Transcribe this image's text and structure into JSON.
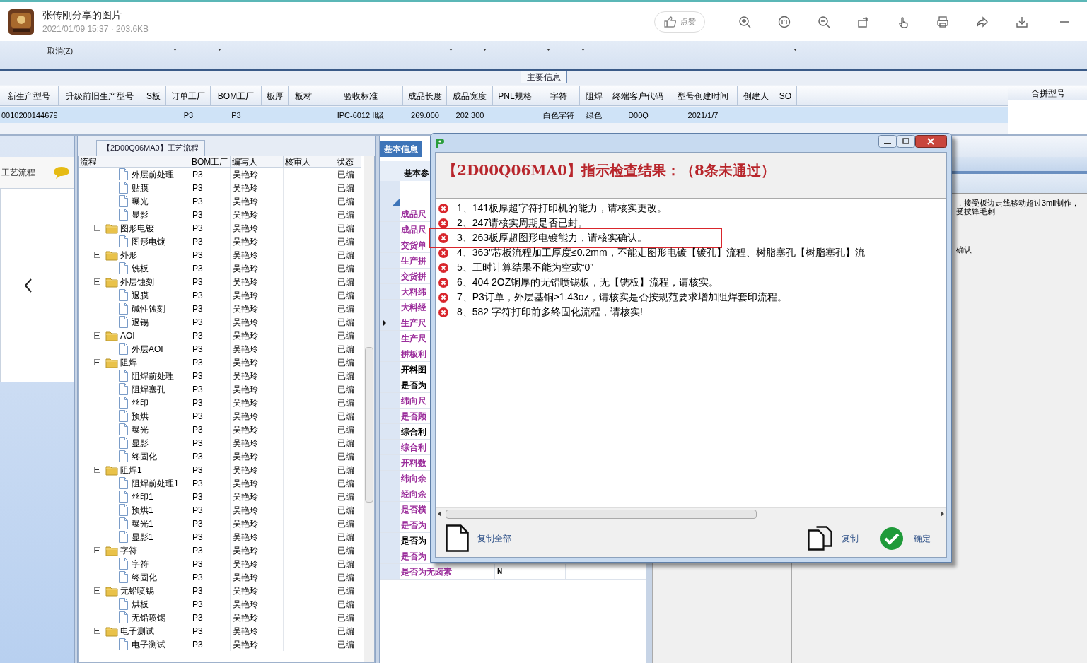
{
  "viewer": {
    "title": "张传刚分享的图片",
    "meta": "2021/01/09 15:37 · 203.6KB",
    "like_label": "点赞"
  },
  "menu": {
    "cancel_label": "取消(Z)"
  },
  "main_section": {
    "label": "主要信息"
  },
  "main_table": {
    "columns": [
      "新生产型号",
      "升级前旧生产型号",
      "S板",
      "订单工厂",
      "BOM工厂",
      "板厚",
      "板材",
      "验收标准",
      "成品长度",
      "成品宽度",
      "PNL规格",
      "字符",
      "阻焊",
      "终端客户代码",
      "型号创建时间",
      "创建人",
      "SO"
    ],
    "rows": [
      {
        "selected": true,
        "cells": [
          "0010200144679",
          "",
          "",
          "P3",
          "P3",
          "",
          "",
          "IPC-6012 II级",
          "269.000",
          "202.300",
          "",
          "白色字符",
          "绿色",
          "D00Q",
          "2021/1/7",
          "",
          ""
        ]
      }
    ],
    "side_column": "合拼型号"
  },
  "left_panel": {
    "label": "工艺流程"
  },
  "flow_panel": {
    "caption": "【2D00Q06MA0】工艺流程",
    "columns": [
      "流程",
      "BOM工厂",
      "编写人",
      "核审人",
      "状态"
    ],
    "items": [
      {
        "kind": "leaf",
        "label": "外层前处理",
        "bom": "P3",
        "writer": "吴艳玲",
        "status": "已编"
      },
      {
        "kind": "leaf",
        "label": "贴膜",
        "bom": "P3",
        "writer": "吴艳玲",
        "status": "已编"
      },
      {
        "kind": "leaf",
        "label": "曝光",
        "bom": "P3",
        "writer": "吴艳玲",
        "status": "已编"
      },
      {
        "kind": "leaf",
        "label": "显影",
        "bom": "P3",
        "writer": "吴艳玲",
        "status": "已编"
      },
      {
        "kind": "folder",
        "label": "图形电镀",
        "bom": "P3",
        "writer": "吴艳玲",
        "status": "已编",
        "expanded": true,
        "children": [
          {
            "kind": "leaf",
            "label": "图形电镀",
            "bom": "P3",
            "writer": "吴艳玲",
            "status": "已编"
          }
        ]
      },
      {
        "kind": "folder",
        "label": "外形",
        "bom": "P3",
        "writer": "吴艳玲",
        "status": "已编",
        "expanded": true,
        "children": [
          {
            "kind": "leaf",
            "label": "铣板",
            "bom": "P3",
            "writer": "吴艳玲",
            "status": "已编"
          }
        ]
      },
      {
        "kind": "folder",
        "label": "外层蚀刻",
        "bom": "P3",
        "writer": "吴艳玲",
        "status": "已编",
        "expanded": true,
        "children": [
          {
            "kind": "leaf",
            "label": "退膜",
            "bom": "P3",
            "writer": "吴艳玲",
            "status": "已编"
          },
          {
            "kind": "leaf",
            "label": "碱性蚀刻",
            "bom": "P3",
            "writer": "吴艳玲",
            "status": "已编"
          },
          {
            "kind": "leaf",
            "label": "退锡",
            "bom": "P3",
            "writer": "吴艳玲",
            "status": "已编"
          }
        ]
      },
      {
        "kind": "folder",
        "label": "AOI",
        "bom": "P3",
        "writer": "吴艳玲",
        "status": "已编",
        "expanded": true,
        "children": [
          {
            "kind": "leaf",
            "label": "外层AOI",
            "bom": "P3",
            "writer": "吴艳玲",
            "status": "已编"
          }
        ]
      },
      {
        "kind": "folder",
        "label": "阻焊",
        "bom": "P3",
        "writer": "吴艳玲",
        "status": "已编",
        "expanded": true,
        "children": [
          {
            "kind": "leaf",
            "label": "阻焊前处理",
            "bom": "P3",
            "writer": "吴艳玲",
            "status": "已编"
          },
          {
            "kind": "leaf",
            "label": "阻焊塞孔",
            "bom": "P3",
            "writer": "吴艳玲",
            "status": "已编"
          },
          {
            "kind": "leaf",
            "label": "丝印",
            "bom": "P3",
            "writer": "吴艳玲",
            "status": "已编"
          },
          {
            "kind": "leaf",
            "label": "预烘",
            "bom": "P3",
            "writer": "吴艳玲",
            "status": "已编"
          },
          {
            "kind": "leaf",
            "label": "曝光",
            "bom": "P3",
            "writer": "吴艳玲",
            "status": "已编"
          },
          {
            "kind": "leaf",
            "label": "显影",
            "bom": "P3",
            "writer": "吴艳玲",
            "status": "已编"
          },
          {
            "kind": "leaf",
            "label": "终固化",
            "bom": "P3",
            "writer": "吴艳玲",
            "status": "已编"
          }
        ]
      },
      {
        "kind": "folder",
        "label": "阻焊1",
        "bom": "P3",
        "writer": "吴艳玲",
        "status": "已编",
        "expanded": true,
        "children": [
          {
            "kind": "leaf",
            "label": "阻焊前处理1",
            "bom": "P3",
            "writer": "吴艳玲",
            "status": "已编"
          },
          {
            "kind": "leaf",
            "label": "丝印1",
            "bom": "P3",
            "writer": "吴艳玲",
            "status": "已编"
          },
          {
            "kind": "leaf",
            "label": "预烘1",
            "bom": "P3",
            "writer": "吴艳玲",
            "status": "已编"
          },
          {
            "kind": "leaf",
            "label": "曝光1",
            "bom": "P3",
            "writer": "吴艳玲",
            "status": "已编"
          },
          {
            "kind": "leaf",
            "label": "显影1",
            "bom": "P3",
            "writer": "吴艳玲",
            "status": "已编"
          }
        ]
      },
      {
        "kind": "folder",
        "label": "字符",
        "bom": "P3",
        "writer": "吴艳玲",
        "status": "已编",
        "expanded": true,
        "children": [
          {
            "kind": "leaf",
            "label": "字符",
            "bom": "P3",
            "writer": "吴艳玲",
            "status": "已编"
          },
          {
            "kind": "leaf",
            "label": "终固化",
            "bom": "P3",
            "writer": "吴艳玲",
            "status": "已编"
          }
        ]
      },
      {
        "kind": "folder",
        "label": "无铅喷锡",
        "bom": "P3",
        "writer": "吴艳玲",
        "status": "已编",
        "expanded": true,
        "children": [
          {
            "kind": "leaf",
            "label": "烘板",
            "bom": "P3",
            "writer": "吴艳玲",
            "status": "已编"
          },
          {
            "kind": "leaf",
            "label": "无铅喷锡",
            "bom": "P3",
            "writer": "吴艳玲",
            "status": "已编"
          }
        ]
      },
      {
        "kind": "folder",
        "label": "电子测试",
        "bom": "P3",
        "writer": "吴艳玲",
        "status": "已编",
        "expanded": true,
        "children": [
          {
            "kind": "leaf",
            "label": "电子测试",
            "bom": "P3",
            "writer": "吴艳玲",
            "status": "已编"
          }
        ]
      }
    ]
  },
  "info_panel": {
    "tab": "基本信息",
    "subtab": "基本参",
    "rows": [
      {
        "label": "成品尺",
        "color": "#9b2d9b",
        "selected": false
      },
      {
        "label": "成品尺",
        "color": "#9b2d9b",
        "selected": false
      },
      {
        "label": "交货单",
        "color": "#9b2d9b",
        "selected": false
      },
      {
        "label": "生产拼",
        "color": "#9b2d9b",
        "selected": false
      },
      {
        "label": "交货拼",
        "color": "#9b2d9b",
        "selected": false
      },
      {
        "label": "大料纬",
        "color": "#9b2d9b",
        "selected": false
      },
      {
        "label": "大料经",
        "color": "#9b2d9b",
        "selected": false
      },
      {
        "label": "生产尺",
        "color": "#9b2d9b",
        "selected": true
      },
      {
        "label": "生产尺",
        "color": "#9b2d9b",
        "selected": false
      },
      {
        "label": "拼板利",
        "color": "#9b2d9b",
        "selected": false
      },
      {
        "label": "开料图",
        "color": "#000000",
        "selected": false
      },
      {
        "label": "是否为",
        "color": "#000000",
        "selected": false
      },
      {
        "label": "纬向尺",
        "color": "#9b2d9b",
        "selected": false
      },
      {
        "label": "是否顾",
        "color": "#9b2d9b",
        "selected": false
      },
      {
        "label": "综合利",
        "color": "#000000",
        "selected": false
      },
      {
        "label": "综合利",
        "color": "#9b2d9b",
        "selected": false
      },
      {
        "label": "开料数",
        "color": "#9b2d9b",
        "selected": false
      },
      {
        "label": "纬向余",
        "color": "#9b2d9b",
        "selected": false
      },
      {
        "label": "经向余",
        "color": "#9b2d9b",
        "selected": false
      },
      {
        "label": "是否横",
        "color": "#9b2d9b",
        "selected": false
      },
      {
        "label": "是否为",
        "color": "#9b2d9b",
        "selected": false
      },
      {
        "label": "是否为",
        "color": "#000000",
        "selected": false
      },
      {
        "label": "是否为",
        "color": "#9b2d9b",
        "selected": false
      },
      {
        "label": "是否为无卤素",
        "color": "#9b2d9b",
        "selected": false,
        "value": "N"
      }
    ]
  },
  "right_panel": {
    "lines": [
      "，接受板边走线移动超过3mil制作，",
      "受披锋毛刺"
    ],
    "note": "确认"
  },
  "dialog": {
    "heading": "【2D00Q06MA0】指示检查结果：（8条未通过）",
    "items": [
      {
        "text": "1、141板厚超字符打印机的能力，请核实更改。",
        "highlighted": false
      },
      {
        "text": "2、247请核实周期是否已封。",
        "highlighted": false
      },
      {
        "text": "3、263板厚超图形电镀能力，请核实确认。",
        "highlighted": true
      },
      {
        "text": "4、363\"芯板流程加工厚度≤0.2mm，不能走图形电镀【镀孔】流程、树脂塞孔【树脂塞孔】流",
        "highlighted": false
      },
      {
        "text": "5、工时计算结果不能为空或“0”",
        "highlighted": false
      },
      {
        "text": "6、404 2OZ铜厚的无铅喷锡板，无【铣板】流程，请核实。",
        "highlighted": false
      },
      {
        "text": "7、P3订单，外层基铜≥1.43oz，请核实是否按规范要求增加阻焊套印流程。",
        "highlighted": false
      },
      {
        "text": "8、582 字符打印前多终固化流程，请核实!",
        "highlighted": false
      }
    ],
    "copy_all": "复制全部",
    "copy": "复制",
    "ok": "确定"
  }
}
